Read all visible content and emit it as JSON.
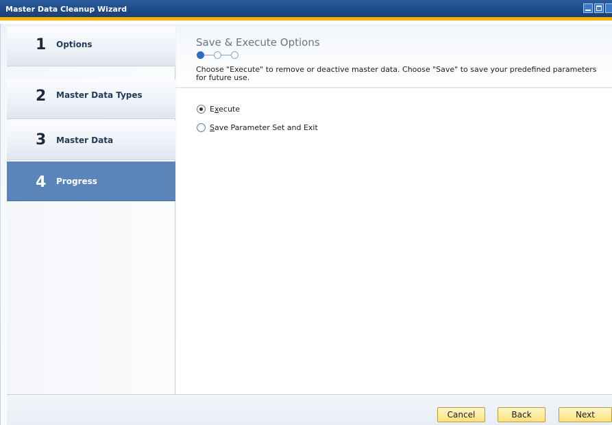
{
  "window": {
    "title": "Master Data Cleanup Wizard"
  },
  "steps": [
    {
      "number": "1",
      "label": "Options",
      "active": false
    },
    {
      "number": "2",
      "label": "Master Data Types",
      "active": false
    },
    {
      "number": "3",
      "label": "Master Data",
      "active": false
    },
    {
      "number": "4",
      "label": "Progress",
      "active": true
    }
  ],
  "header": {
    "title": "Save & Execute Options",
    "progress": {
      "current": 1,
      "total": 3
    },
    "description": "Choose \"Execute\" to remove or deactive master data. Choose \"Save\" to save your predefined parameters for future use."
  },
  "options": [
    {
      "label_first": "E",
      "label_underlined": "x",
      "label_rest": "ecute",
      "checked": true
    },
    {
      "label_first": "",
      "label_underlined": "S",
      "label_rest": "ave Parameter Set and Exit",
      "checked": false
    }
  ],
  "footer": {
    "cancel_label": "Cancel",
    "back_label": "Back",
    "next_label": "Next"
  },
  "colors": {
    "titlebar": "#1e4a86",
    "accent_strip": "#f5b400",
    "active_step": "#5b85b9",
    "button_fill": "#ffe27a"
  }
}
